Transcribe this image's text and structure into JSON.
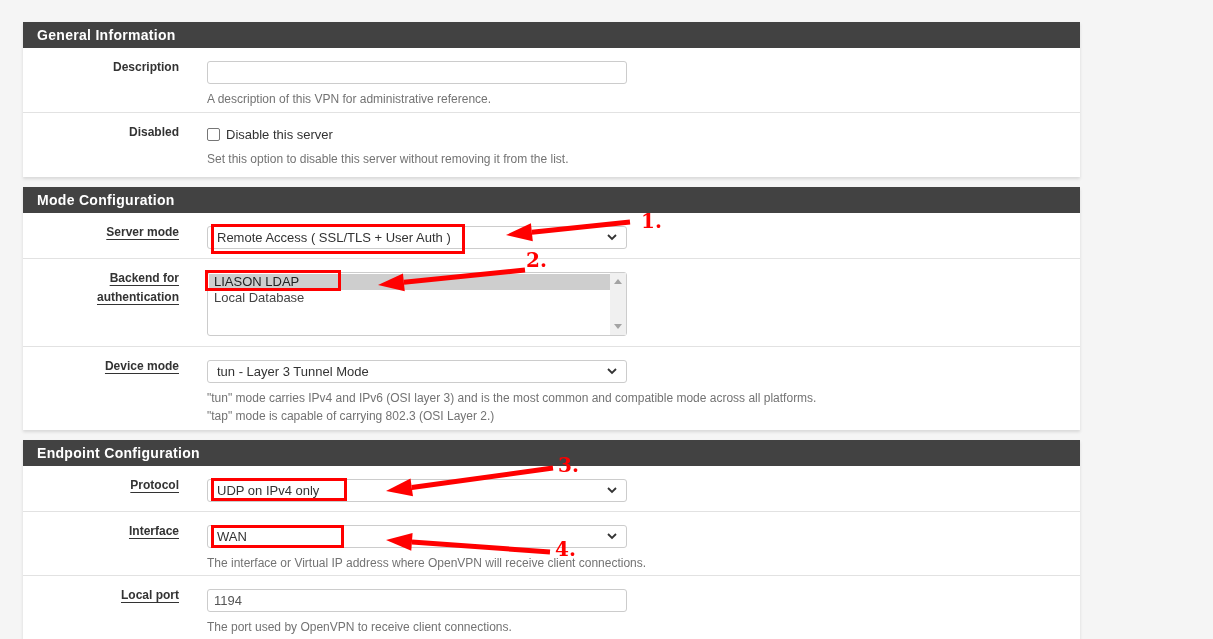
{
  "sections": [
    {
      "title": "General Information",
      "rows": [
        {
          "kind": "text",
          "label": "Description",
          "help_link": false,
          "value": "",
          "help": [
            "A description of this VPN for administrative reference."
          ]
        },
        {
          "kind": "checkbox",
          "label": "Disabled",
          "help_link": false,
          "checkbox_label": "Disable this server",
          "checked": false,
          "help": [
            "Set this option to disable this server without removing it from the list."
          ]
        }
      ]
    },
    {
      "title": "Mode Configuration",
      "rows": [
        {
          "kind": "select",
          "label": "Server mode",
          "help_link": true,
          "value": "Remote Access ( SSL/TLS + User Auth )"
        },
        {
          "kind": "listbox",
          "label": "Backend for authentication",
          "help_link": true,
          "options": [
            {
              "label": "LIASON LDAP",
              "selected": true
            },
            {
              "label": "Local Database",
              "selected": false
            }
          ]
        },
        {
          "kind": "select",
          "label": "Device mode",
          "help_link": true,
          "value": "tun - Layer 3 Tunnel Mode",
          "help": [
            "\"tun\" mode carries IPv4 and IPv6 (OSI layer 3) and is the most common and compatible mode across all platforms.",
            "\"tap\" mode is capable of carrying 802.3 (OSI Layer 2.)"
          ]
        }
      ]
    },
    {
      "title": "Endpoint Configuration",
      "rows": [
        {
          "kind": "select",
          "label": "Protocol",
          "help_link": true,
          "value": "UDP on IPv4 only"
        },
        {
          "kind": "select",
          "label": "Interface",
          "help_link": true,
          "value": "WAN",
          "help": [
            "The interface or Virtual IP address where OpenVPN will receive client connections."
          ]
        },
        {
          "kind": "text",
          "label": "Local port",
          "help_link": true,
          "value": "1194",
          "help": [
            "The port used by OpenVPN to receive client connections."
          ]
        }
      ]
    }
  ],
  "annotations": [
    {
      "number": "1."
    },
    {
      "number": "2."
    },
    {
      "number": "3."
    },
    {
      "number": "4."
    }
  ]
}
